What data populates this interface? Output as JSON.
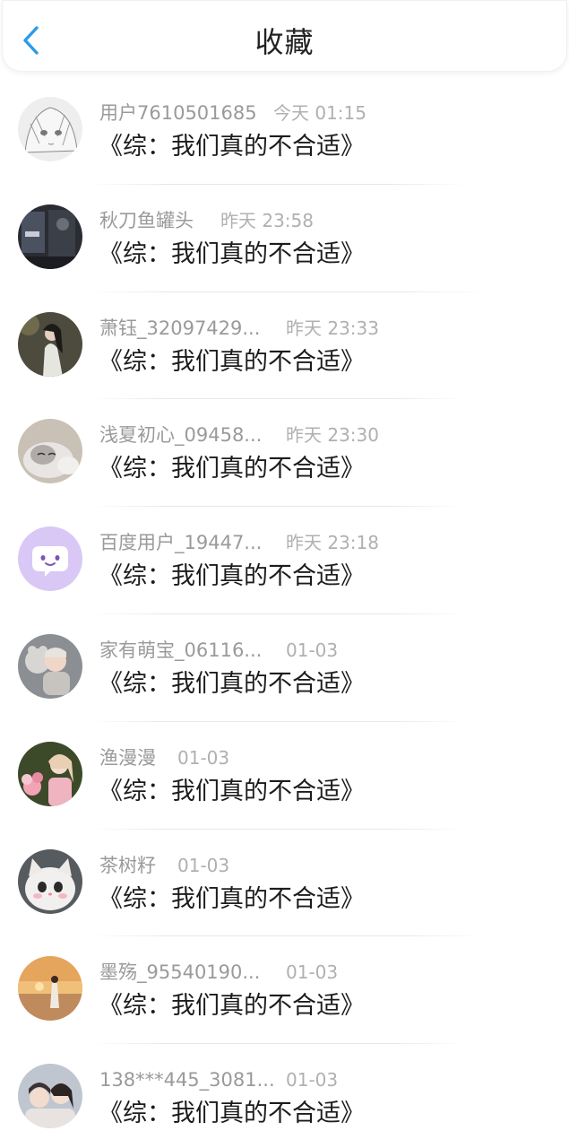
{
  "header": {
    "title": "收藏",
    "back_icon": "chevron-left-icon",
    "accent_color": "#2b9be8"
  },
  "items": [
    {
      "username": "用户7610501685",
      "time": "今天 01:15",
      "title": "《综：我们真的不合适》",
      "avatar": "anime-girl-sketch-avatar"
    },
    {
      "username": "秋刀鱼罐头",
      "time": "昨天 23:58",
      "title": "《综：我们真的不合适》",
      "avatar": "dark-photo-avatar"
    },
    {
      "username": "萧钰_32097429...",
      "time": "昨天 23:33",
      "title": "《综：我们真的不合适》",
      "avatar": "ancient-costume-avatar"
    },
    {
      "username": "浅夏初心_09458...",
      "time": "昨天 23:30",
      "title": "《综：我们真的不合适》",
      "avatar": "kitten-avatar"
    },
    {
      "username": "百度用户_19447...",
      "time": "昨天 23:18",
      "title": "《综：我们真的不合适》",
      "avatar": "purple-chat-bubble-avatar"
    },
    {
      "username": "家有萌宝_06116...",
      "time": "01-03",
      "title": "《综：我们真的不合适》",
      "avatar": "baby-avatar"
    },
    {
      "username": "渔漫漫",
      "time": "01-03",
      "title": "《综：我们真的不合适》",
      "avatar": "girl-flowers-avatar"
    },
    {
      "username": "茶树籽",
      "time": "01-03",
      "title": "《综：我们真的不合适》",
      "avatar": "fluffy-cat-avatar"
    },
    {
      "username": "墨殇_95540190...",
      "time": "01-03",
      "title": "《综：我们真的不合适》",
      "avatar": "sunset-beach-avatar"
    },
    {
      "username": "138***445_3081...",
      "time": "01-03",
      "title": "《综：我们真的不合适》",
      "avatar": "two-girls-avatar"
    }
  ]
}
